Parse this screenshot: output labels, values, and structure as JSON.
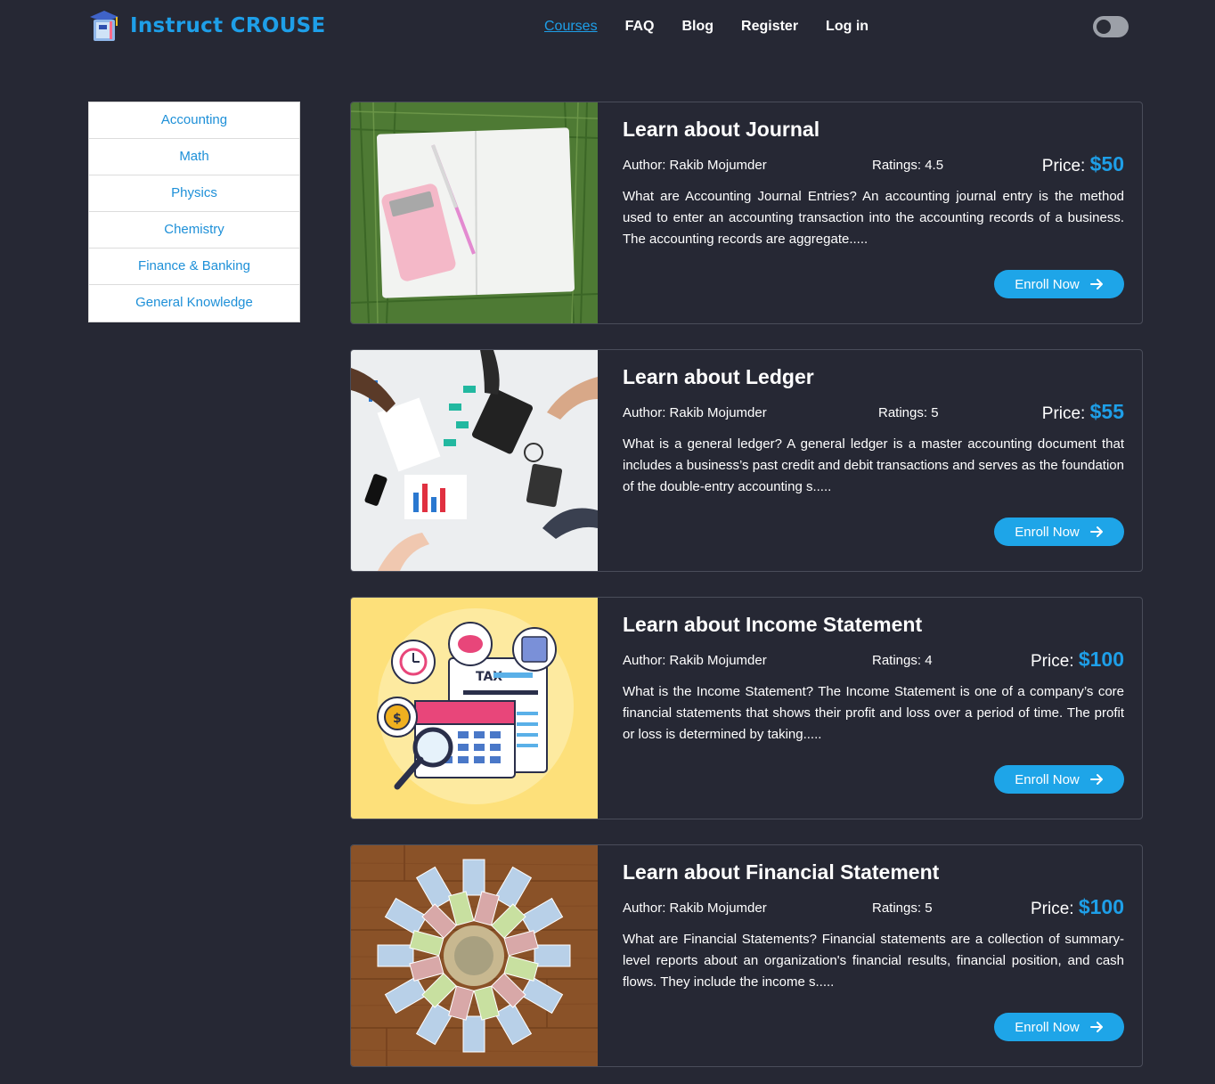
{
  "brand": {
    "name": "Instruct CROUSE",
    "icon": "book-logo-icon",
    "color": "#1e9fe8"
  },
  "nav": {
    "items": [
      {
        "label": "Courses",
        "active": true
      },
      {
        "label": "FAQ",
        "active": false
      },
      {
        "label": "Blog",
        "active": false
      },
      {
        "label": "Register",
        "active": false
      },
      {
        "label": "Log in",
        "active": false
      }
    ],
    "theme_toggle": {
      "icon": "dark-mode-toggle",
      "on": false
    }
  },
  "sidebar": {
    "categories": [
      {
        "label": "Accounting"
      },
      {
        "label": "Math"
      },
      {
        "label": "Physics"
      },
      {
        "label": "Chemistry"
      },
      {
        "label": "Finance & Banking"
      },
      {
        "label": "General Knowledge"
      }
    ]
  },
  "courses": [
    {
      "title": "Learn about Journal",
      "author": "Author: Rakib Mojumder",
      "ratings": "Ratings: 4.5",
      "price_label": "Price:",
      "price": "$50",
      "description": "What are Accounting Journal Entries? An accounting journal entry is the method used to enter an accounting transaction into the accounting records of a business. The accounting records are aggregate.....",
      "button": "Enroll Now",
      "image": "notebook-calculator-on-grass"
    },
    {
      "title": "Learn about Ledger",
      "author": "Author: Rakib Mojumder",
      "ratings": "Ratings: 5",
      "price_label": "Price:",
      "price": "$55",
      "description": "What is a general ledger? A general ledger is a master accounting document that includes a business’s past credit and debit transactions and serves as the foundation of the double-entry accounting s.....",
      "button": "Enroll Now",
      "image": "team-working-on-charts"
    },
    {
      "title": "Learn about Income Statement",
      "author": "Author: Rakib Mojumder",
      "ratings": "Ratings: 4",
      "price_label": "Price:",
      "price": "$100",
      "description": "What is the Income Statement? The Income Statement is one of a company’s core financial statements that shows their profit and loss over a period of time. The profit or loss is determined by taking.....",
      "button": "Enroll Now",
      "image": "tax-calendar-illustration",
      "image_text": "TAX"
    },
    {
      "title": "Learn about Financial Statement",
      "author": "Author: Rakib Mojumder",
      "ratings": "Ratings: 5",
      "price_label": "Price:",
      "price": "$100",
      "description": "What are Financial Statements? Financial statements are a collection of summary-level reports about an organization's financial results, financial position, and cash flows. They include the income s.....",
      "button": "Enroll Now",
      "image": "banknotes-on-wooden-floor"
    }
  ],
  "colors": {
    "background": "#262834",
    "accent": "#1e9fe8",
    "button": "#1ea5e8",
    "card_border": "#4a4d5a"
  }
}
